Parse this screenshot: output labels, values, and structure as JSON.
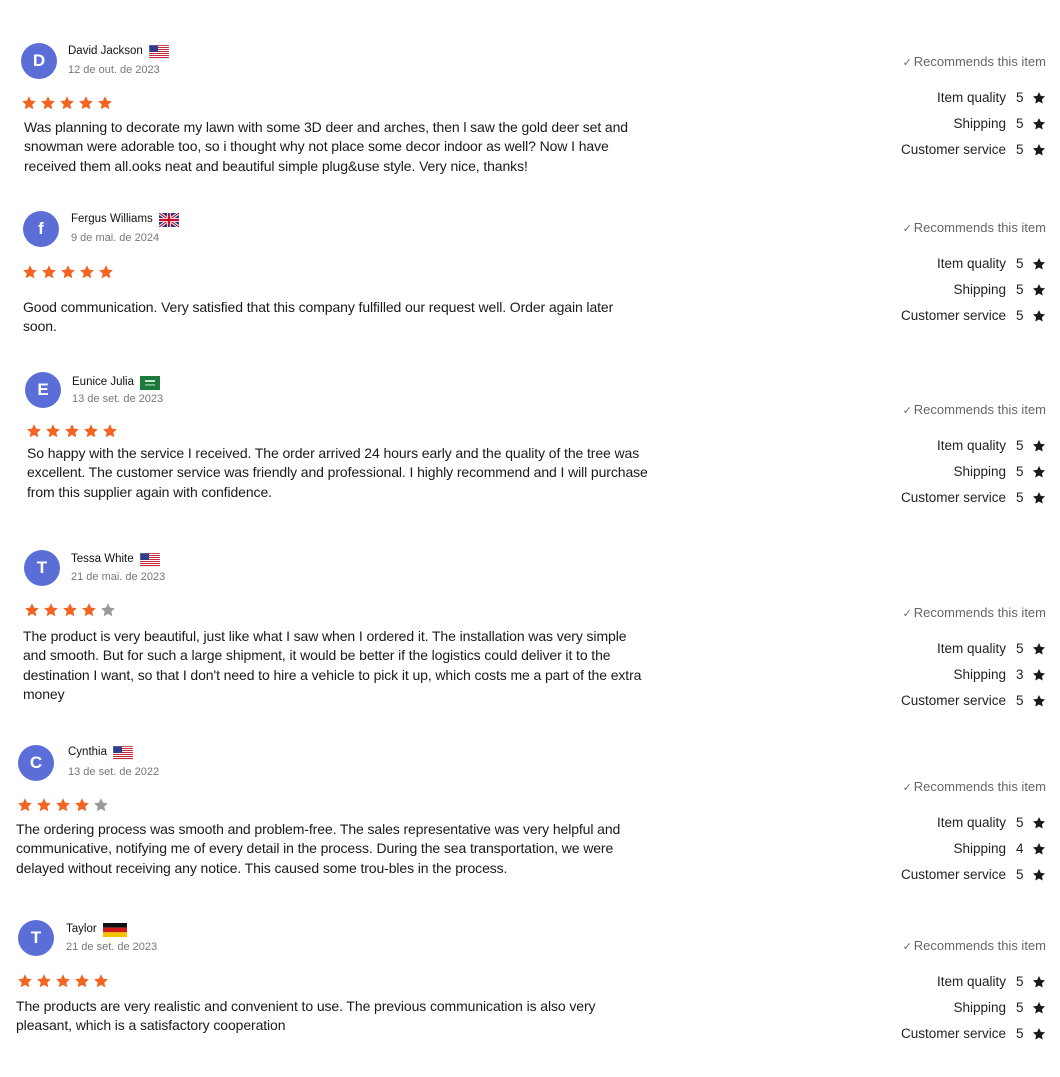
{
  "recommend_label": "Recommends this item",
  "metric_labels": [
    "Item quality",
    "Shipping",
    "Customer service"
  ],
  "colors": {
    "star_filled": "#f26422",
    "star_empty": "#9a9a9a",
    "avatar": "#5b6ed8",
    "metric_star": "#1a1a1a"
  },
  "reviews": [
    {
      "initial": "D",
      "name": "David Jackson",
      "flag": "us-flag",
      "date": "12 de out. de 2023",
      "rating": 5,
      "text": "Was planning to decorate my lawn with some 3D deer and arches, then l saw the gold deer set and snowman were adorable too, so i thought why not place some decor indoor as well? Now I have received them all.ooks neat and beautiful simple plug&use style. Very nice, thanks!",
      "scores": [
        "5",
        "5",
        "5"
      ]
    },
    {
      "initial": "f",
      "name": "Fergus Williams",
      "flag": "uk-flag",
      "date": "9 de mai. de 2024",
      "rating": 5,
      "text": "Good communication. Very satisfied that this company fulfilled our request well. Order again later soon.",
      "scores": [
        "5",
        "5",
        "5"
      ]
    },
    {
      "initial": "E",
      "name": "Eunice Julia",
      "flag": "saudi-flag",
      "date": "13 de set. de 2023",
      "rating": 5,
      "text": "So happy with the service I received. The order arrived 24 hours early and the quality of the tree was excellent. The customer service was friendly and professional. I highly recommend and I will purchase from this supplier again with confidence.",
      "scores": [
        "5",
        "5",
        "5"
      ]
    },
    {
      "initial": "T",
      "name": "Tessa White",
      "flag": "us-flag",
      "date": "21 de mai. de 2023",
      "rating": 4,
      "text": "The product is very beautiful, just like what I saw when I ordered it. The installation was very simple and smooth. But for such a large shipment, it would be better if the logistics could deliver it to the destination I want, so that I don't need to hire a vehicle to pick it up, which costs me a part of the extra money",
      "scores": [
        "5",
        "3",
        "5"
      ]
    },
    {
      "initial": "C",
      "name": "Cynthia",
      "flag": "us-flag",
      "date": "13 de set. de 2022",
      "rating": 4,
      "text": "The ordering process was smooth and problem-free. The sales representative was very helpful and communicative, notifying me of every detail in the process. During the sea transportation, we were delayed without receiving any notice. This caused some trou-bles in the process.",
      "scores": [
        "5",
        "4",
        "5"
      ]
    },
    {
      "initial": "T",
      "name": "Taylor",
      "flag": "germany-flag",
      "date": "21 de set. de 2023",
      "rating": 5,
      "text": "The products are very realistic and convenient to use. The previous communication is also very pleasant, which is a satisfactory cooperation",
      "scores": [
        "5",
        "5",
        "5"
      ]
    }
  ]
}
